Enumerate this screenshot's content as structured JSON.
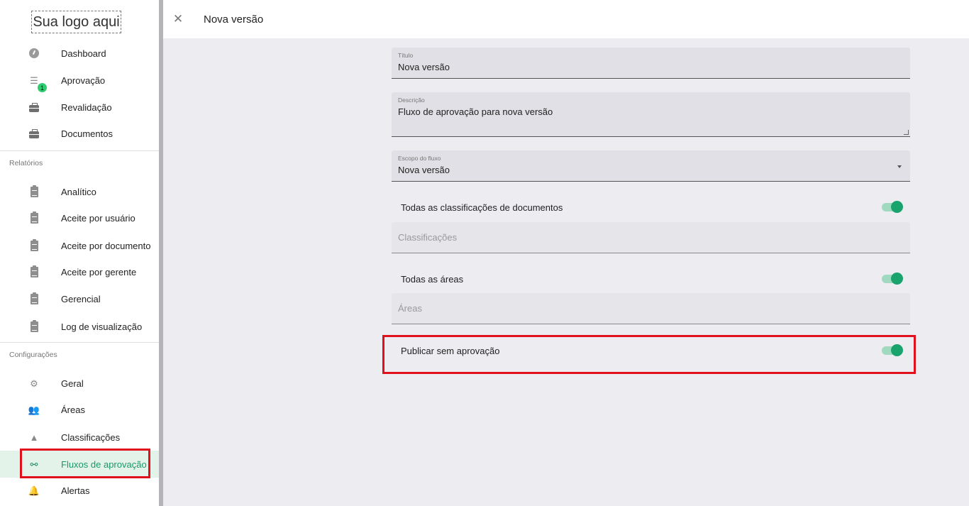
{
  "logo": "Sua logo aqui",
  "sidebar": {
    "items": [
      {
        "label": "Dashboard",
        "icon": "dashboard-icon"
      },
      {
        "label": "Aprovação",
        "icon": "checklist-icon",
        "badge": "1"
      },
      {
        "label": "Revalidação",
        "icon": "briefcase-clock-icon"
      },
      {
        "label": "Documentos",
        "icon": "briefcase-icon"
      }
    ],
    "reports_label": "Relatórios",
    "reports": [
      {
        "label": "Analítico"
      },
      {
        "label": "Aceite por usuário"
      },
      {
        "label": "Aceite por documento"
      },
      {
        "label": "Aceite por gerente"
      },
      {
        "label": "Gerencial"
      },
      {
        "label": "Log de visualização"
      }
    ],
    "config_label": "Configurações",
    "config": [
      {
        "label": "Geral",
        "icon": "gears-icon"
      },
      {
        "label": "Áreas",
        "icon": "people-icon"
      },
      {
        "label": "Classificações",
        "icon": "shapes-icon"
      },
      {
        "label": "Fluxos de aprovação",
        "icon": "flow-icon",
        "active": true
      },
      {
        "label": "Alertas",
        "icon": "bell-icon"
      }
    ]
  },
  "header": {
    "title": "Nova versão"
  },
  "form": {
    "titulo": {
      "label": "Título",
      "value": "Nova versão"
    },
    "descricao": {
      "label": "Descrição",
      "value": "Fluxo de aprovação para nova versão"
    },
    "escopo": {
      "label": "Escopo do fluxo",
      "value": "Nova versão"
    },
    "todas_classificacoes": {
      "label": "Todas as classificações de documentos",
      "on": true
    },
    "classificacoes": {
      "placeholder": "Classificações"
    },
    "todas_areas": {
      "label": "Todas as áreas",
      "on": true
    },
    "areas": {
      "placeholder": "Áreas"
    },
    "publicar": {
      "label": "Publicar sem aprovação",
      "on": true
    }
  },
  "colors": {
    "accent": "#1aa36d",
    "highlight": "#e0101c",
    "active_bg": "#e3f3ea"
  }
}
